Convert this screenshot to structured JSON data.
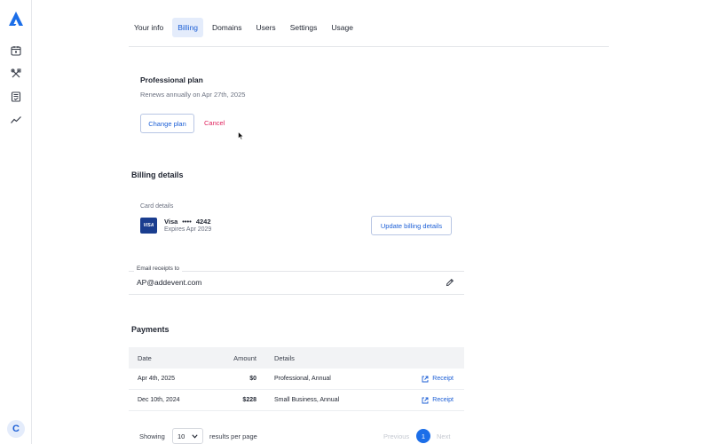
{
  "sidebar": {
    "logo_icon": "addevent-logo-icon",
    "items": [
      {
        "icon": "calendar-icon"
      },
      {
        "icon": "tools-icon"
      },
      {
        "icon": "checklist-icon"
      },
      {
        "icon": "analytics-icon"
      }
    ],
    "avatar_initial": "C"
  },
  "tabs": [
    {
      "label": "Your info",
      "active": false
    },
    {
      "label": "Billing",
      "active": true
    },
    {
      "label": "Domains",
      "active": false
    },
    {
      "label": "Users",
      "active": false
    },
    {
      "label": "Settings",
      "active": false
    },
    {
      "label": "Usage",
      "active": false
    }
  ],
  "plan": {
    "title": "Professional plan",
    "renews": "Renews annually on Apr 27th, 2025",
    "change_label": "Change plan",
    "cancel_label": "Cancel"
  },
  "billing": {
    "title": "Billing details",
    "card_label": "Card details",
    "card_brand": "Visa",
    "card_badge": "VISA",
    "card_mask": "••••",
    "card_last4": "4242",
    "card_expires": "Expires Apr 2029",
    "update_label": "Update billing details"
  },
  "email": {
    "label": "Email receipts to",
    "value": "AP@addevent.com"
  },
  "payments": {
    "title": "Payments",
    "columns": {
      "date": "Date",
      "amount": "Amount",
      "details": "Details"
    },
    "rows": [
      {
        "date": "Apr 4th, 2025",
        "amount": "$0",
        "details": "Professional, Annual",
        "receipt": "Receipt"
      },
      {
        "date": "Dec 10th, 2024",
        "amount": "$228",
        "details": "Small Business, Annual",
        "receipt": "Receipt"
      }
    ]
  },
  "pagination": {
    "showing_label": "Showing",
    "page_size": "10",
    "per_page_label": "results per page",
    "previous_label": "Previous",
    "current_page": "1",
    "next_label": "Next"
  },
  "colors": {
    "accent": "#1c5fd6",
    "danger": "#e0245e",
    "visa": "#1a3d8f"
  }
}
